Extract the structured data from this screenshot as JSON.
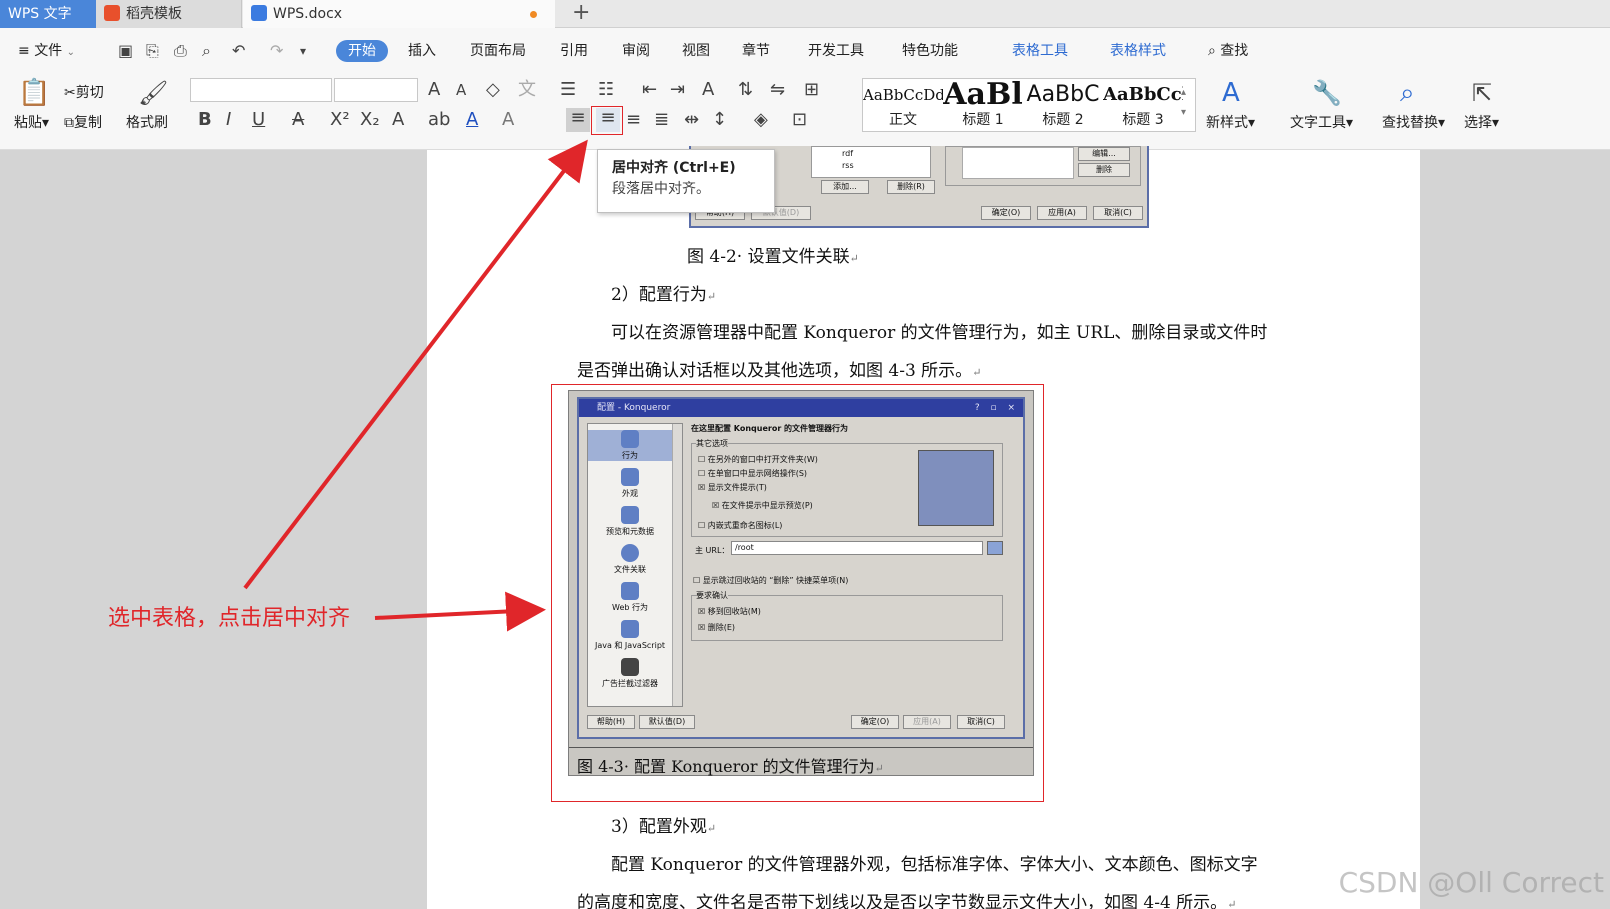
{
  "tabs": [
    {
      "label": "WPS 文字"
    },
    {
      "label": "稻壳模板"
    },
    {
      "label": "WPS.docx"
    }
  ],
  "menu": {
    "file": "文件",
    "items": [
      "开始",
      "插入",
      "页面布局",
      "引用",
      "审阅",
      "视图",
      "章节",
      "开发工具",
      "特色功能",
      "表格工具",
      "表格样式",
      "查找"
    ]
  },
  "ribbon": {
    "paste": "粘贴",
    "cut": "剪切",
    "copy": "复制",
    "format_painter": "格式刷",
    "styles": [
      {
        "preview": "AaBbCcDd",
        "label": "正文"
      },
      {
        "preview": "AaBl",
        "label": "标题 1"
      },
      {
        "preview": "AaBbC",
        "label": "标题 2"
      },
      {
        "preview": "AaBbCcl",
        "label": "标题 3"
      }
    ],
    "new_style": "新样式",
    "text_tools": "文字工具",
    "find_replace": "查找替换",
    "select": "选择"
  },
  "tooltip": {
    "title": "居中对齐 (Ctrl+E)",
    "desc": "段落居中对齐。"
  },
  "document": {
    "caption_42": "图 4-2· 设置文件关联",
    "heading_2": "2）配置行为",
    "para_1a": "可以在资源管理器中配置 Konqueror 的文件管理行为，如主 URL、删除目录或文件时",
    "para_1b": "是否弹出确认对话框以及其他选项，如图 4-3 所示。",
    "caption_43": "图 4-3· 配置 Konqueror 的文件管理行为",
    "heading_3": "3）配置外观",
    "para_2a": "配置 Konqueror 的文件管理器外观，包括标准字体、字体大小、文本颜色、图标文字",
    "para_2b": "的高度和宽度、文件名是否带下划线以及是否以字节数显示文件大小，如图 4-4 所示。"
  },
  "fig42": {
    "items": [
      "rdf",
      "rss"
    ],
    "add": "添加...",
    "delete": "删除(R)",
    "edit": "编辑...",
    "remove": "删除",
    "help": "帮助(H)",
    "default": "默认值(D)",
    "ok": "确定(O)",
    "apply": "应用(A)",
    "cancel": "取消(C)"
  },
  "dialog": {
    "title": "配置 - Konqueror",
    "header": "在这里配置 Konqueror 的文件管理器行为",
    "group_misc": "其它选项",
    "opt1": "在另外的窗口中打开文件夹(W)",
    "opt2": "在单窗口中显示网络操作(S)",
    "opt3": "显示文件提示(T)",
    "opt4": "在文件提示中显示预览(P)",
    "opt5": "内嵌式重命名图标(L)",
    "url_label": "主 URL：",
    "url_value": "/root",
    "opt6": "显示跳过回收站的 “删除” 快捷菜单项(N)",
    "group_confirm": "要求确认",
    "opt7": "移到回收站(M)",
    "opt8": "删除(E)",
    "sidebar": [
      "行为",
      "外观",
      "预览和元数据",
      "文件关联",
      "Web 行为",
      "Java 和 JavaScript",
      "广告拦截过滤器"
    ],
    "btn_help": "帮助(H)",
    "btn_default": "默认值(D)",
    "btn_ok": "确定(O)",
    "btn_apply": "应用(A)",
    "btn_cancel": "取消(C)"
  },
  "annotation": "选中表格，点击居中对齐",
  "watermark": "CSDN @Oll Correct",
  "colors": {
    "accent": "#4a86d9",
    "annotation": "#e0262a"
  }
}
